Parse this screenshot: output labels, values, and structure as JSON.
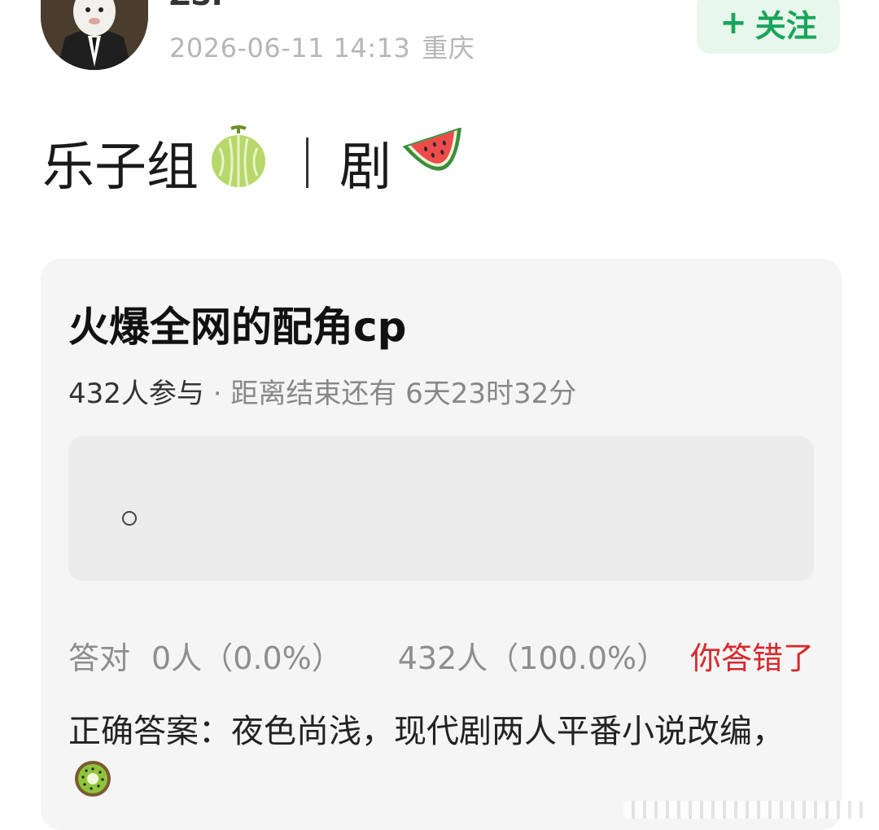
{
  "header": {
    "username": "ZSP",
    "timestamp": "2026-06-11 14:13",
    "location": "重庆",
    "follow_plus": "+",
    "follow_label": "关注"
  },
  "post": {
    "title_left": "乐子组",
    "emoji_left": "melon-icon",
    "title_right": "剧",
    "emoji_right": "watermelon-icon"
  },
  "quiz": {
    "title": "火爆全网的配角cp",
    "participants": "432人参与",
    "countdown": "· 距离结束还有 6天23时32分",
    "option_text": "",
    "stats": {
      "correct_label": "答对",
      "correct_count": "0人（0.0%）",
      "wrong_count": "432人（100.0%）",
      "result": "你答错了"
    },
    "answer_text": "正确答案：夜色尚浅，现代剧两人平番小说改编，",
    "answer_emoji": "kiwi-icon"
  },
  "colors": {
    "accent_green": "#18a55a",
    "follow_bg": "#e7f7ec",
    "wrong_red": "#d8282a",
    "card_bg": "#f5f5f5"
  }
}
